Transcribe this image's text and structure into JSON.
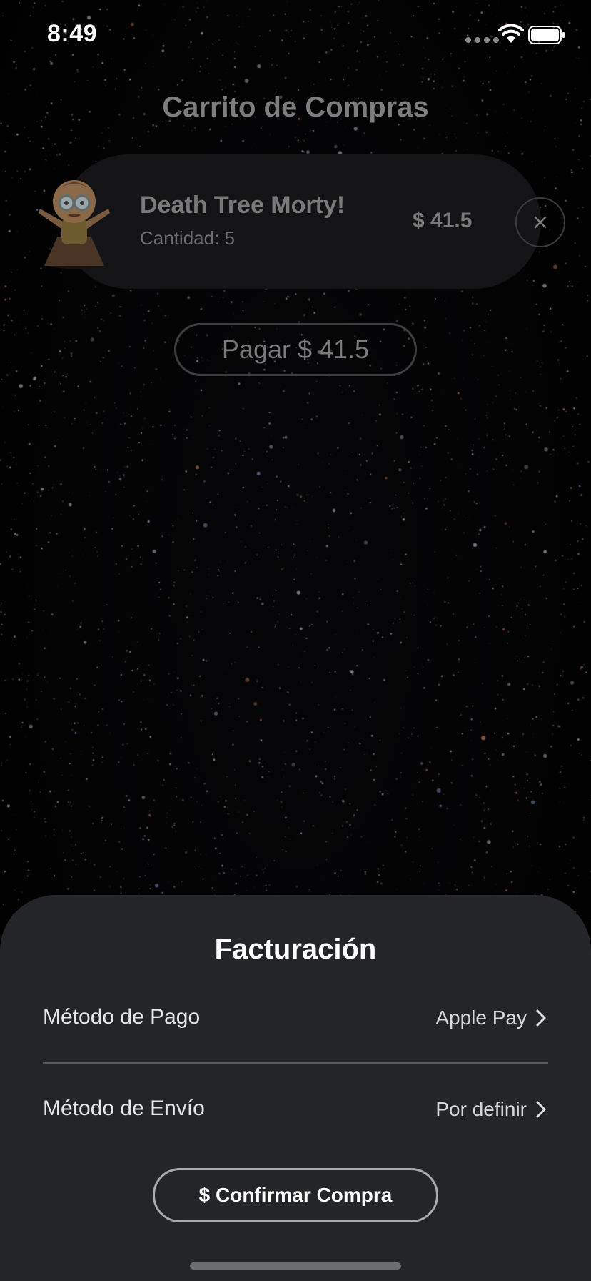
{
  "status_bar": {
    "time": "8:49"
  },
  "cart": {
    "title": "Carrito de Compras",
    "items": [
      {
        "name": "Death Tree Morty!",
        "quantity_label": "Cantidad: 5",
        "price": "$ 41.5"
      }
    ],
    "pay_button_label": "Pagar $ 41.5"
  },
  "billing": {
    "title": "Facturación",
    "rows": [
      {
        "label": "Método de Pago",
        "value": "Apple Pay"
      },
      {
        "label": "Método de Envío",
        "value": "Por definir"
      }
    ],
    "confirm_label": "$ Confirmar Compra"
  },
  "icons": {
    "remove": "close-icon",
    "row_chevron": "chevron-right-icon",
    "wifi": "wifi-icon",
    "battery": "battery-icon"
  },
  "colors": {
    "sheet_background": "#232528",
    "cart_card_background": "#141416"
  }
}
